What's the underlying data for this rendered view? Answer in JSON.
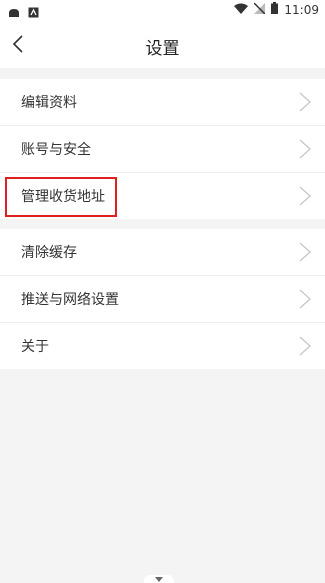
{
  "status_bar": {
    "time": "11:09"
  },
  "header": {
    "title": "设置"
  },
  "groups": [
    {
      "items": [
        {
          "label": "编辑资料"
        },
        {
          "label": "账号与安全"
        },
        {
          "label": "管理收货地址"
        }
      ]
    },
    {
      "items": [
        {
          "label": "清除缓存"
        },
        {
          "label": "推送与网络设置"
        },
        {
          "label": "关于"
        }
      ]
    }
  ]
}
